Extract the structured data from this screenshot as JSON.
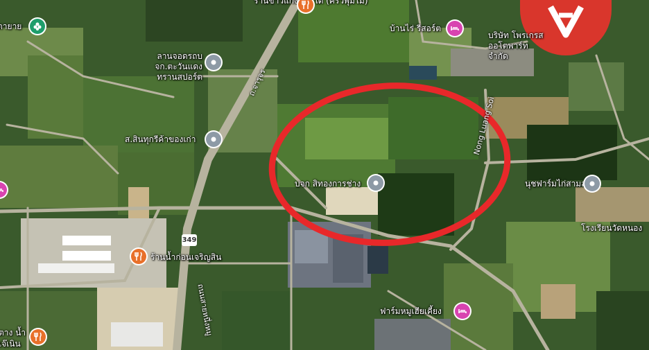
{
  "map": {
    "highlight_color": "#e8282a",
    "route_shield": "349",
    "road_names": {
      "main_road": "ถ.จารุจร",
      "road_north": "Nong Luang Soi",
      "road_south": "ถนนสายหนึ่งหมู"
    },
    "places": [
      {
        "label": "ร้านข้าวแกงบักษ์ใต้ (ครัวพุ่มไม้)",
        "category": "food",
        "color": "#e8702a",
        "icon": "restaurant-icon"
      },
      {
        "label": "ตายาย",
        "category": "park",
        "color": "#1e9e6b",
        "icon": "flower-icon"
      },
      {
        "label": "ลานจอดรถบจก.ตะวันแดง ทรานสปอร์ต",
        "category": "poi",
        "color": "#8d9aa6",
        "icon": "location-dot-icon"
      },
      {
        "label": "ส.สินทุกรีค้าของเก่า",
        "category": "poi",
        "color": "#8d9aa6",
        "icon": "location-dot-icon"
      },
      {
        "label": "บจก สิทองการช่าง",
        "category": "poi",
        "color": "#8d9aa6",
        "icon": "location-dot-icon"
      },
      {
        "label": "บ้านไร่ รีสอร์ต",
        "category": "lodging",
        "color": "#d844b0",
        "icon": "bed-icon"
      },
      {
        "label": "บริษัท โพรเกรส ออโตพาร์ท จำกัด",
        "category": "poi",
        "color": "#8d9aa6",
        "icon": "location-dot-icon"
      },
      {
        "label": "นุชฟาร์มไก่สามสาย",
        "category": "poi",
        "color": "#8d9aa6",
        "icon": "location-dot-icon"
      },
      {
        "label": "โรงเรียนวัดหนอง",
        "category": "school",
        "color": "#8d9aa6",
        "icon": "school-icon"
      },
      {
        "label": "ร้านน้ำก่อนเจริญสิน",
        "category": "food",
        "color": "#e8702a",
        "icon": "restaurant-icon"
      },
      {
        "label": "ฟาร์มหมูเฮียเคี้ยง",
        "category": "lodging",
        "color": "#d844b0",
        "icon": "bed-icon"
      },
      {
        "label": "ตาง น้ำ",
        "category": "food",
        "color": "#e8702a",
        "icon": "restaurant-icon"
      },
      {
        "label": "เจ๊เนิน",
        "category": "text",
        "color": "#ffffff",
        "icon": ""
      }
    ]
  }
}
